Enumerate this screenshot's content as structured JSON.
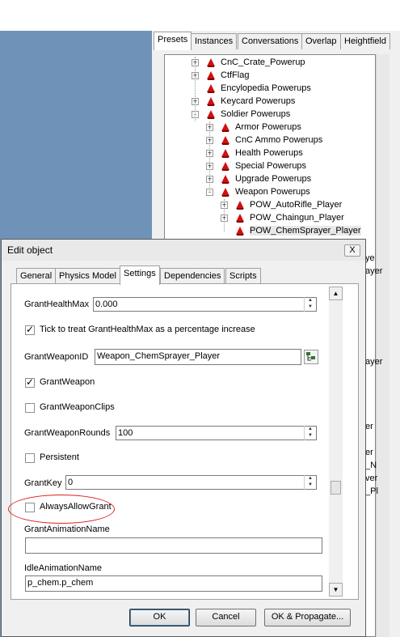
{
  "panel_tabs": [
    "Presets",
    "Instances",
    "Conversations",
    "Overlap",
    "Heightfield"
  ],
  "tree": [
    {
      "label": "CnC_Crate_Powerup",
      "expander": "+"
    },
    {
      "label": "CtfFlag",
      "expander": "+"
    },
    {
      "label": "Encylopedia Powerups",
      "expander": ""
    },
    {
      "label": "Keycard Powerups",
      "expander": "+"
    },
    {
      "label": "Soldier Powerups",
      "expander": "-"
    },
    {
      "label": "Armor Powerups",
      "expander": "+"
    },
    {
      "label": "CnC Ammo Powerups",
      "expander": "+"
    },
    {
      "label": "Health Powerups",
      "expander": "+"
    },
    {
      "label": "Special Powerups",
      "expander": "+"
    },
    {
      "label": "Upgrade Powerups",
      "expander": "+"
    },
    {
      "label": "Weapon Powerups",
      "expander": "-"
    },
    {
      "label": "POW_AutoRifle_Player",
      "expander": "+"
    },
    {
      "label": "POW_Chaingun_Player",
      "expander": "+"
    },
    {
      "label": "POW_ChemSprayer_Player",
      "expander": ""
    }
  ],
  "peek_text": [
    "ye",
    "ayer",
    "ayer",
    "er",
    "er",
    "_N",
    "ver",
    "_Pl"
  ],
  "dialog": {
    "title": "Edit object",
    "close_label": "X",
    "tabs": [
      "General",
      "Physics Model",
      "Settings",
      "Dependencies",
      "Scripts"
    ],
    "fields": {
      "grant_health_max_label": "GrantHealthMax",
      "grant_health_max_value": "0.000",
      "pct_checkbox_label": "Tick to treat GrantHealthMax as a percentage increase",
      "grant_weapon_id_label": "GrantWeaponID",
      "grant_weapon_id_value": "Weapon_ChemSprayer_Player",
      "grant_weapon_label": "GrantWeapon",
      "grant_weapon_clips_label": "GrantWeaponClips",
      "grant_weapon_rounds_label": "GrantWeaponRounds",
      "grant_weapon_rounds_value": "100",
      "persistent_label": "Persistent",
      "grant_key_label": "GrantKey",
      "grant_key_value": "0",
      "always_allow_grant_label": "AlwaysAllowGrant",
      "grant_animation_name_label": "GrantAnimationName",
      "grant_animation_name_value": "",
      "idle_animation_name_label": "IdleAnimationName",
      "idle_animation_name_value": "p_chem.p_chem"
    },
    "checks": {
      "pct": true,
      "grant_weapon": true,
      "grant_weapon_clips": false,
      "persistent": false,
      "always_allow_grant": false
    },
    "buttons": {
      "ok": "OK",
      "cancel": "Cancel",
      "ok_propagate": "OK & Propagate..."
    }
  },
  "colors": {
    "viewport": "#6f93b8",
    "annotation": "#e02020",
    "powerup_icon": "#cc1111"
  }
}
